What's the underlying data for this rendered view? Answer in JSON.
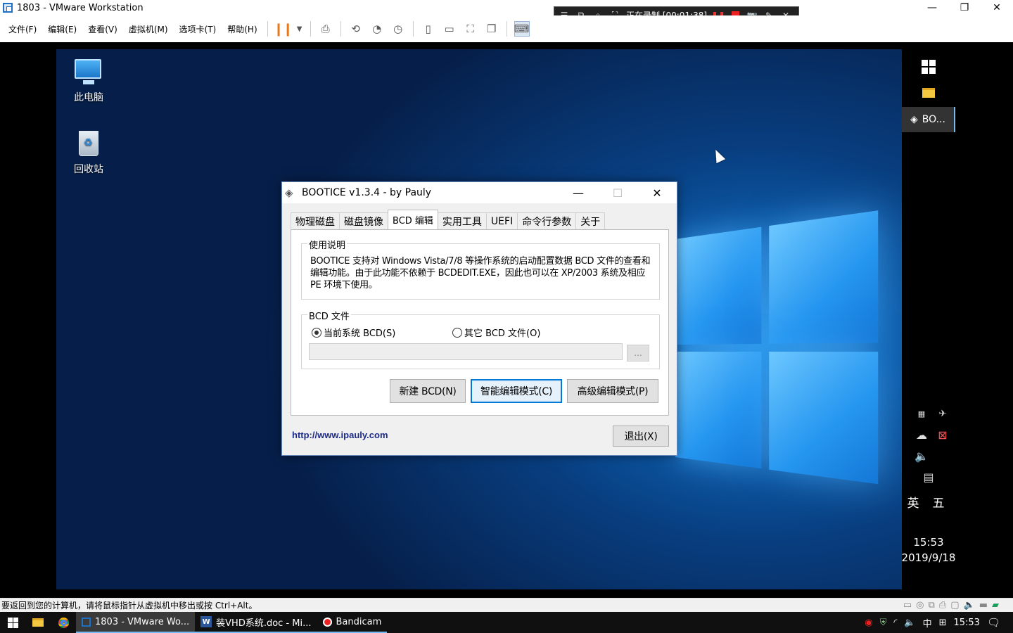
{
  "vmware": {
    "title": "1803 - VMware Workstation",
    "menus": [
      "文件(F)",
      "编辑(E)",
      "查看(V)",
      "虚拟机(M)",
      "选项卡(T)",
      "帮助(H)"
    ],
    "status_text": "要返回到您的计算机，请将鼠标指针从虚拟机中移出或按 Ctrl+Alt。"
  },
  "bandicam": {
    "recording_text": "正在录制 [00:01:38]"
  },
  "desktop": {
    "icons": [
      {
        "label": "此电脑"
      },
      {
        "label": "回收站"
      }
    ]
  },
  "guest_taskbar": {
    "app_label": "BO...",
    "time": "15:53",
    "date": "2019/9/18",
    "ime_lang": "英",
    "ime_mode": "五"
  },
  "bootice": {
    "title": "BOOTICE v1.3.4 - by Pauly",
    "tabs": [
      "物理磁盘",
      "磁盘镜像",
      "BCD 编辑",
      "实用工具",
      "UEFI",
      "命令行参数",
      "关于"
    ],
    "active_tab": "BCD 编辑",
    "usage_label": "使用说明",
    "usage_text": "BOOTICE 支持对 Windows Vista/7/8 等操作系统的启动配置数据 BCD 文件的查看和编辑功能。由于此功能不依赖于 BCDEDIT.EXE，因此也可以在 XP/2003 系统及相应 PE 环境下使用。",
    "bcd_file_label": "BCD 文件",
    "radio_current": "当前系统 BCD(S)",
    "radio_other": "其它 BCD 文件(O)",
    "path_value": "",
    "browse_label": "...",
    "btn_new": "新建 BCD(N)",
    "btn_smart": "智能编辑模式(C)",
    "btn_advanced": "高级编辑模式(P)",
    "link": "http://www.ipauly.com",
    "btn_exit": "退出(X)"
  },
  "host_taskbar": {
    "apps": [
      {
        "label": "1803 - VMware Wo..."
      },
      {
        "label": "装VHD系统.doc - Mi..."
      },
      {
        "label": "Bandicam"
      }
    ],
    "ime": "中",
    "time": "15:53"
  },
  "colors": {
    "accent": "#0078d7",
    "link": "#1c2b8a",
    "vm_pause": "#e7771b",
    "rec_red": "#e22222"
  }
}
